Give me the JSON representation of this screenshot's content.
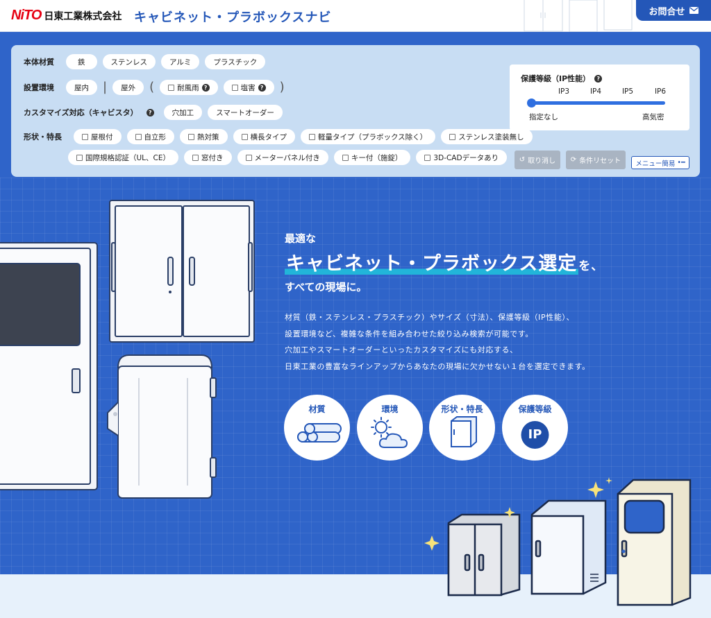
{
  "header": {
    "logo_mark": "NiTO",
    "company": "日東工業株式会社",
    "site_title": "キャビネット・プラボックスナビ",
    "contact_label": "お問合せ"
  },
  "filters": {
    "material": {
      "label": "本体材質",
      "options": [
        "鉄",
        "ステンレス",
        "アルミ",
        "プラスチック"
      ]
    },
    "environment": {
      "label": "設置環境",
      "options": [
        "屋内",
        "屋外"
      ],
      "checks": [
        "耐風雨",
        "塩害"
      ]
    },
    "customize": {
      "label": "カスタマイズ対応（キャビスタ）",
      "options": [
        "穴加工",
        "スマートオーダー"
      ]
    },
    "shape": {
      "label": "形状・特長",
      "row1": [
        "屋根付",
        "自立形",
        "熱対策",
        "横長タイプ",
        "軽量タイプ（プラボックス除く）",
        "ステンレス塗装無し"
      ],
      "row2": [
        "国際規格認証（UL、CE）",
        "窓付き",
        "メーターパネル付き",
        "キー付（施錠）",
        "3D-CADデータあり"
      ]
    },
    "ip": {
      "title": "保護等級（IP性能）",
      "ticks": [
        "IP3",
        "IP4",
        "IP5",
        "IP6"
      ],
      "min_label": "指定なし",
      "max_label": "高気密",
      "selected": "指定なし"
    },
    "buttons": {
      "undo": "取り消し",
      "reset": "条件リセット",
      "menu": "メニュー簡易"
    }
  },
  "hero": {
    "lead1": "最適な",
    "lead2": "キャビネット・プラボックス選定",
    "lead2_tail": "を、",
    "lead3": "すべての現場に。",
    "desc": [
      "材質（鉄・ステンレス・プラスチック）やサイズ（寸法）、保護等級（IP性能）、",
      "設置環境など、複雑な条件を組み合わせた絞り込み検索が可能です。",
      "穴加工やスマートオーダーといったカスタマイズにも対応する、",
      "日東工業の豊富なラインアップからあなたの現場に欠かせない１台を選定できます。"
    ],
    "circles": [
      "材質",
      "環境",
      "形状・特長",
      "保護等級"
    ],
    "ip_badge": "IP"
  },
  "colors": {
    "brand_blue": "#2457b8",
    "hero_blue": "#2f64c9",
    "panel_bg": "#c8ddf3",
    "logo_red": "#e60012",
    "highlight": "#22b5d9"
  }
}
